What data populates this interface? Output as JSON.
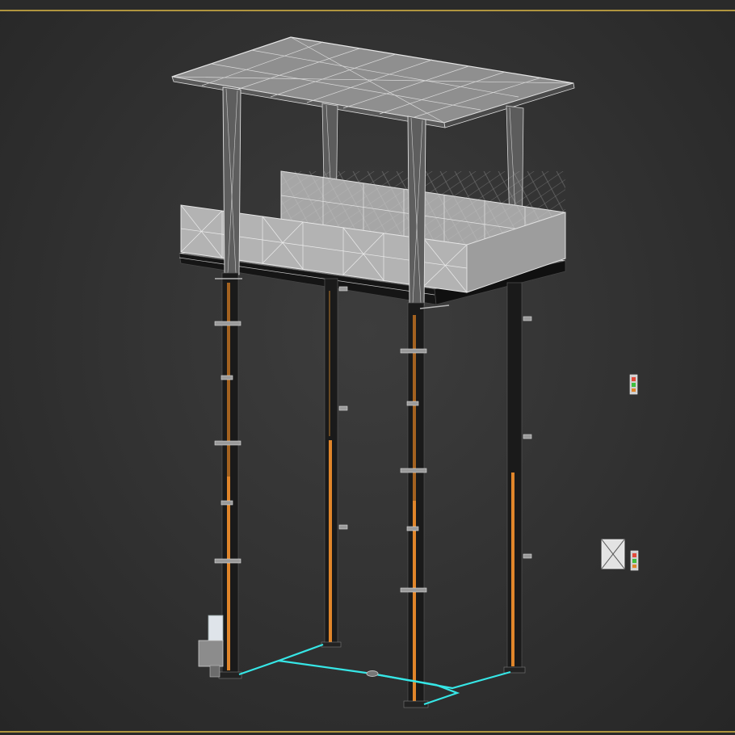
{
  "app": {
    "name": "3D viewport",
    "view": "perspective"
  },
  "colors": {
    "background_center": "#3d3d3d",
    "background_edge": "#262626",
    "frame_accent": "#b0953f",
    "panel_fill": "#a9a9a9",
    "panel_wire": "#d8d8d8",
    "post_orange": "#e0852a",
    "post_dark": "#1a1a1a",
    "cable_cyan": "#36e6e6"
  },
  "scene": {
    "objects": [
      "roof-panel",
      "support-column-front-left",
      "support-column-front-right",
      "support-column-back-left",
      "support-column-back-right",
      "railing-front",
      "railing-back",
      "platform-deck",
      "post-front-left",
      "post-front-right",
      "post-back-left",
      "post-back-right",
      "ground-cable",
      "control-box",
      "small-device-upper",
      "small-device-lower",
      "junction-box"
    ]
  }
}
